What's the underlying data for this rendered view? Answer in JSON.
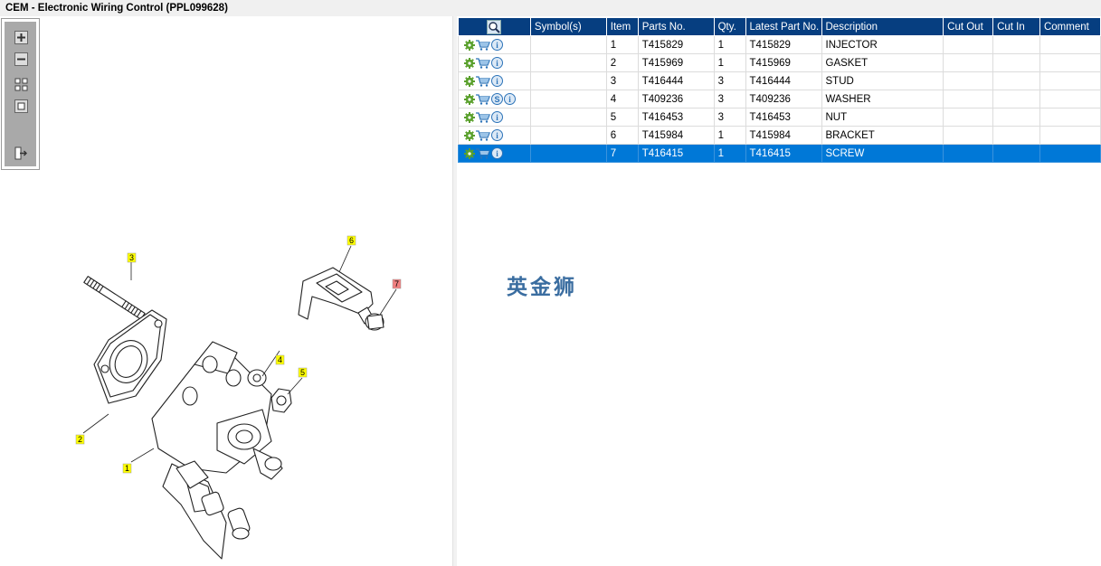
{
  "window": {
    "title": "CEM - Electronic Wiring Control (PPL099628)"
  },
  "toolbar": {
    "buttons": [
      {
        "name": "zoom-in-button",
        "icon": "zoom-in-icon"
      },
      {
        "name": "zoom-out-button",
        "icon": "zoom-out-icon"
      },
      {
        "name": "fit-all-button",
        "icon": "fit-all-icon"
      },
      {
        "name": "fit-window-button",
        "icon": "fit-window-icon"
      },
      {
        "name": "export-button",
        "icon": "export-icon"
      }
    ]
  },
  "diagram": {
    "callouts": [
      {
        "label": "1",
        "highlighted": false
      },
      {
        "label": "2",
        "highlighted": false
      },
      {
        "label": "3",
        "highlighted": false
      },
      {
        "label": "4",
        "highlighted": false
      },
      {
        "label": "5",
        "highlighted": false
      },
      {
        "label": "6",
        "highlighted": false
      },
      {
        "label": "7",
        "highlighted": true
      }
    ],
    "callout_color": "#ffff00",
    "highlight_color": "#f28080"
  },
  "parts_table": {
    "header_icon": "search-icon",
    "columns": [
      "Symbol(s)",
      "Item",
      "Parts No.",
      "Qty.",
      "Latest Part No.",
      "Description",
      "Cut Out",
      "Cut In",
      "Comment"
    ],
    "rows": [
      {
        "symbols": [
          "gear-icon",
          "cart-icon",
          "info-icon"
        ],
        "symbol_s": "",
        "item": "1",
        "part_no": "T415829",
        "qty": "1",
        "latest": "T415829",
        "description": "INJECTOR",
        "cut_out": "",
        "cut_in": "",
        "comment": "",
        "selected": false
      },
      {
        "symbols": [
          "gear-icon",
          "cart-icon",
          "info-icon"
        ],
        "symbol_s": "",
        "item": "2",
        "part_no": "T415969",
        "qty": "1",
        "latest": "T415969",
        "description": "GASKET",
        "cut_out": "",
        "cut_in": "",
        "comment": "",
        "selected": false
      },
      {
        "symbols": [
          "gear-icon",
          "cart-icon",
          "info-icon"
        ],
        "symbol_s": "",
        "item": "3",
        "part_no": "T416444",
        "qty": "3",
        "latest": "T416444",
        "description": "STUD",
        "cut_out": "",
        "cut_in": "",
        "comment": "",
        "selected": false
      },
      {
        "symbols": [
          "gear-icon",
          "cart-icon",
          "supersession-icon",
          "info-icon"
        ],
        "symbol_s": "S",
        "item": "4",
        "part_no": "T409236",
        "qty": "3",
        "latest": "T409236",
        "description": "WASHER",
        "cut_out": "",
        "cut_in": "",
        "comment": "",
        "selected": false
      },
      {
        "symbols": [
          "gear-icon",
          "cart-icon",
          "info-icon"
        ],
        "symbol_s": "",
        "item": "5",
        "part_no": "T416453",
        "qty": "3",
        "latest": "T416453",
        "description": "NUT",
        "cut_out": "",
        "cut_in": "",
        "comment": "",
        "selected": false
      },
      {
        "symbols": [
          "gear-icon",
          "cart-icon",
          "info-icon"
        ],
        "symbol_s": "",
        "item": "6",
        "part_no": "T415984",
        "qty": "1",
        "latest": "T415984",
        "description": "BRACKET",
        "cut_out": "",
        "cut_in": "",
        "comment": "",
        "selected": false
      },
      {
        "symbols": [
          "gear-icon",
          "cart-icon",
          "info-icon"
        ],
        "symbol_s": "",
        "item": "7",
        "part_no": "T416415",
        "qty": "1",
        "latest": "T416415",
        "description": "SCREW",
        "cut_out": "",
        "cut_in": "",
        "comment": "",
        "selected": true
      }
    ]
  },
  "watermark": {
    "text": "英金狮"
  },
  "colors": {
    "header_bg": "#063e80",
    "selected_row": "#0078d7",
    "gear": "#5aa02c",
    "cart": "#2c73b8",
    "info": "#2c73b8"
  }
}
